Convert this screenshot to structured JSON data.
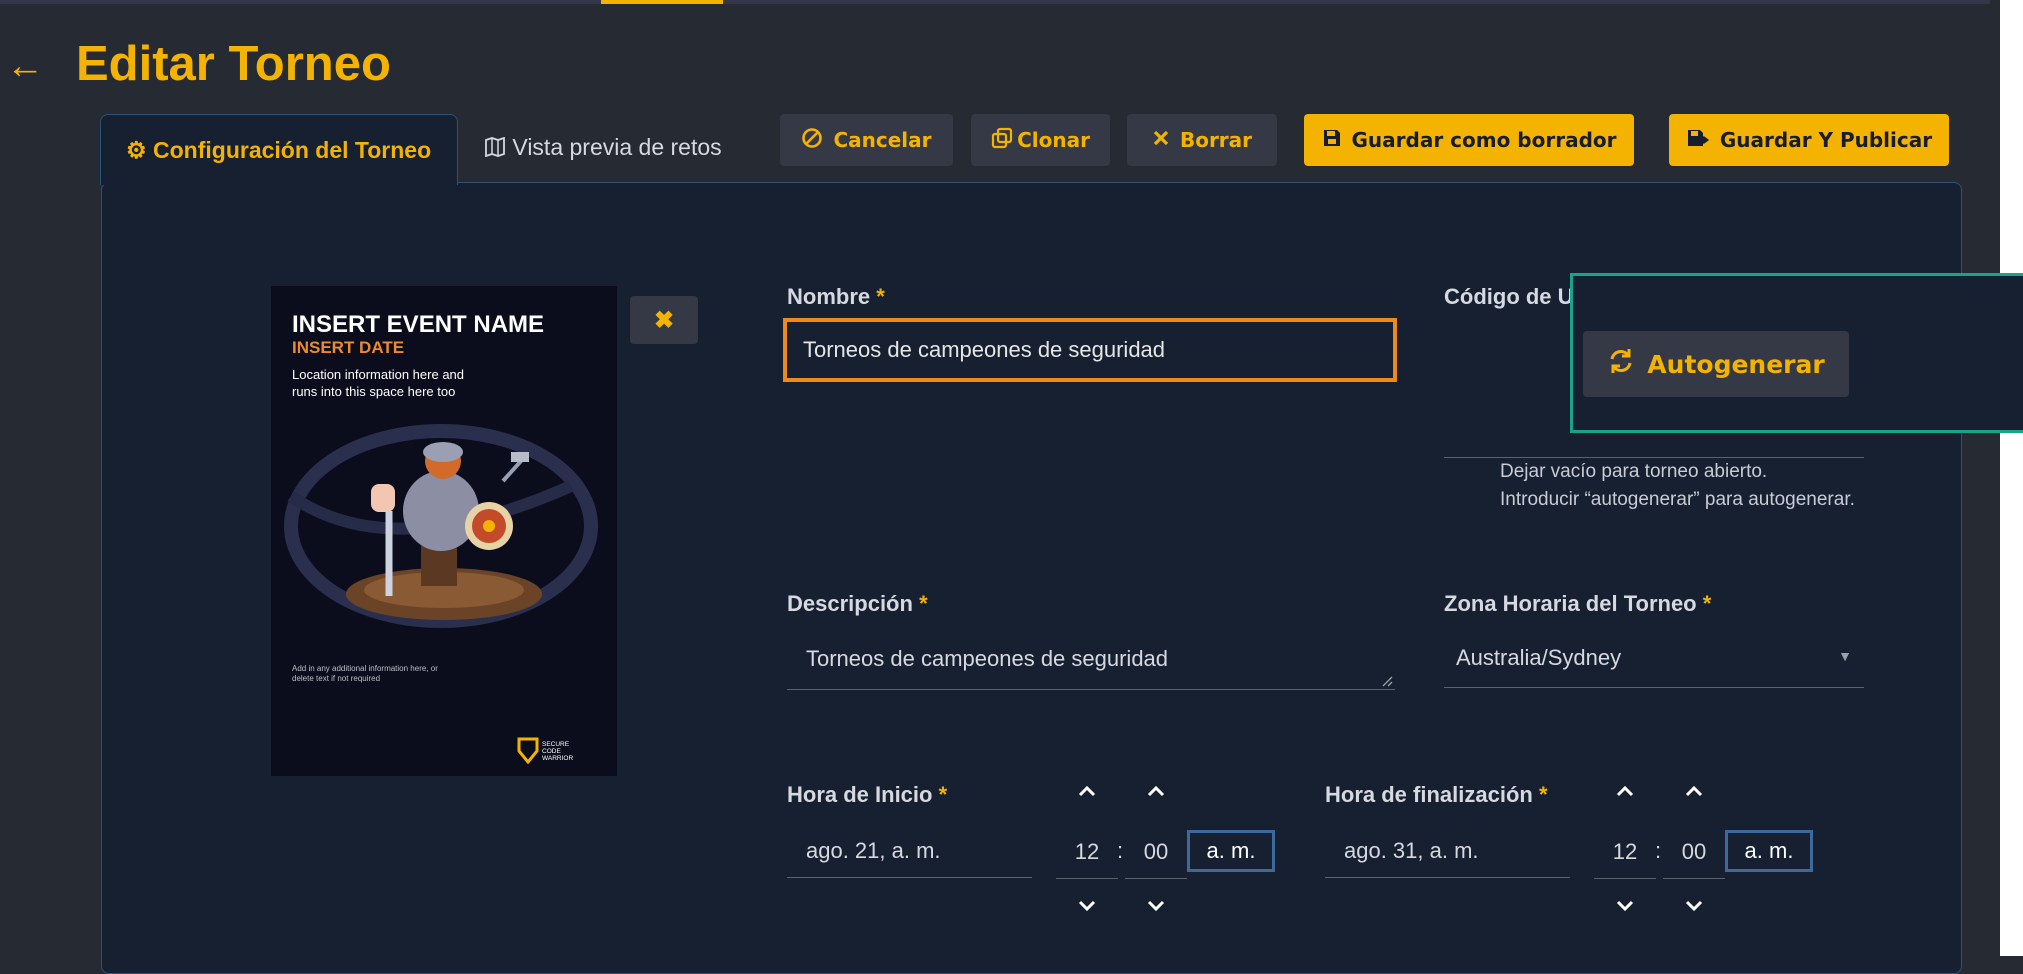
{
  "page": {
    "title": "Editar Torneo"
  },
  "tabs": [
    {
      "label": "Configuración del Torneo",
      "active": true
    },
    {
      "label": "Vista previa de retos",
      "active": false
    }
  ],
  "toolbar": {
    "cancel_label": "Cancelar",
    "clone_label": "Clonar",
    "delete_label": "Borrar",
    "save_draft_label": "Guardar como borrador",
    "save_publish_label": "Guardar Y Publicar"
  },
  "poster": {
    "event_name": "INSERT EVENT NAME",
    "event_date": "INSERT DATE",
    "location": "Location information here and runs into this space here too",
    "extra": "Add in any additional information here, or delete text if not required",
    "logo_text": "SECURE CODE WARRIOR"
  },
  "form": {
    "name_label": "Nombre",
    "name_value": "Torneos de campeones de seguridad",
    "code_label": "Código de U",
    "autogen_label": "Autogenerar",
    "code_help_1": "Dejar vacío para torneo abierto.",
    "code_help_2": "Introducir “autogenerar” para autogenerar.",
    "description_label": "Descripción",
    "description_value": "Torneos de campeones de seguridad",
    "timezone_label": "Zona Horaria del Torneo",
    "timezone_value": "Australia/Sydney",
    "start_label": "Hora de Inicio",
    "start_date": "ago. 21, a. m.",
    "start_hour": "12",
    "start_minute": "00",
    "start_ampm": "a. m.",
    "end_label": "Hora de finalización",
    "end_date": "ago. 31, a. m.",
    "end_hour": "12",
    "end_minute": "00",
    "end_ampm": "a. m.",
    "required_mark": "*",
    "colon": ":"
  },
  "colors": {
    "accent": "#f5b301",
    "panel": "#172031",
    "focus": "#ee8a19",
    "highlight": "#17a589"
  }
}
